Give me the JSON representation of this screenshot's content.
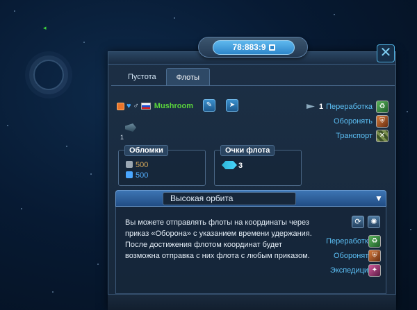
{
  "coordinates": "78:883:9",
  "tabs": [
    {
      "label": "Пустота",
      "active": false
    },
    {
      "label": "Флоты",
      "active": true
    }
  ],
  "player": {
    "gender_symbol": "♂",
    "name": "Mushroom"
  },
  "fleet": {
    "count": "1",
    "ship_count": "1"
  },
  "missions_top": [
    {
      "label": "Переработка",
      "icon": "recycle-icon"
    },
    {
      "label": "Оборонять",
      "icon": "defend-icon"
    },
    {
      "label": "Транспорт",
      "icon": "transport-icon"
    }
  ],
  "debris": {
    "title": "Обломки",
    "metal": "500",
    "crystal": "500"
  },
  "fleet_points": {
    "title": "Очки флота",
    "value": "3"
  },
  "orbit": {
    "title": "Высокая орбита",
    "toggle": "▼",
    "description": "Вы можете отправлять флоты на координаты через приказ «Оборона» с указанием времени удержания. После достижения флотом координат будет возможна отправка с них флота с любым приказом.",
    "missions": [
      {
        "label": "Переработка",
        "icon": "recycle-icon"
      },
      {
        "label": "Оборонять",
        "icon": "defend-icon"
      },
      {
        "label": "Экспедиция",
        "icon": "expedition-icon"
      }
    ]
  },
  "colors": {
    "accent": "#5cc0f5",
    "player_name": "#5ad43c",
    "metal": "#d6a95a",
    "crystal": "#55b0ff"
  }
}
